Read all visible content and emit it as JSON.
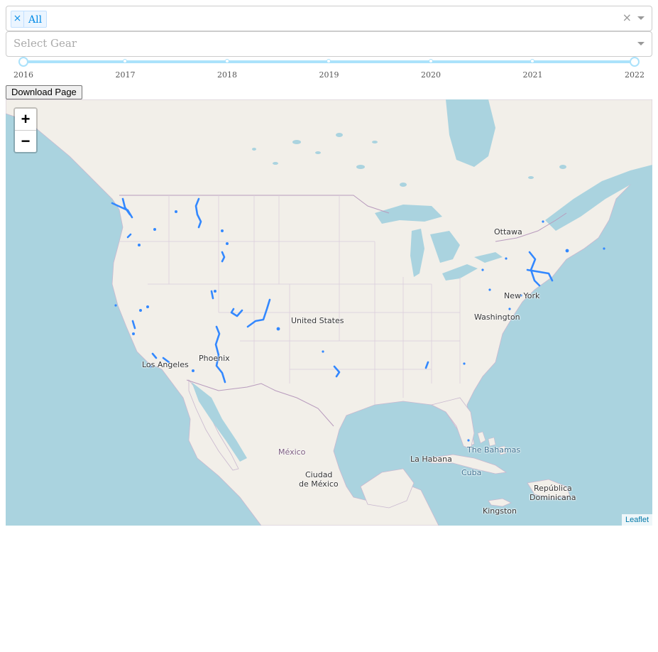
{
  "activity_filter": {
    "selected_tag": "All",
    "tag_remove": "×",
    "clear": "×"
  },
  "gear_filter": {
    "placeholder": "Select Gear"
  },
  "year_slider": {
    "marks": [
      "2016",
      "2017",
      "2018",
      "2019",
      "2020",
      "2021",
      "2022"
    ],
    "range": [
      "2016",
      "2022"
    ]
  },
  "download_button": "Download Page",
  "map": {
    "zoom_in": "+",
    "zoom_out": "−",
    "attribution": "Leaflet",
    "track_color": "#3388ff",
    "labels": {
      "ottawa": "Ottawa",
      "new_york": "New York",
      "washington": "Washington",
      "united_states": "United States",
      "phoenix": "Phoenix",
      "los_angeles": "Los Angeles",
      "mexico": "México",
      "ciudad": "Ciudad",
      "de_mexico": "de México",
      "la_habana": "La Habana",
      "the_bahamas": "The Bahamas",
      "cuba": "Cuba",
      "republica": "República",
      "dominicana": "Dominicana",
      "kingston": "Kingston"
    }
  }
}
